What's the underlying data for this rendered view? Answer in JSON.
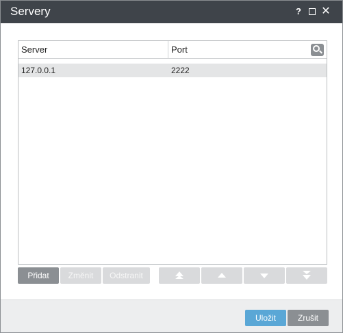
{
  "window": {
    "title": "Servery",
    "help_glyph": "?",
    "close_glyph": "✕"
  },
  "table": {
    "columns": [
      "Server",
      "Port"
    ],
    "rows": [
      {
        "server": "127.0.0.1",
        "port": "2222"
      }
    ]
  },
  "toolbar": {
    "add_label": "Přidat",
    "edit_label": "Změnit",
    "delete_label": "Odstranit"
  },
  "footer": {
    "save_label": "Uložit",
    "cancel_label": "Zrušit"
  },
  "colors": {
    "titlebar": "#3f444a",
    "primary_button": "#5aa7d6",
    "secondary_button": "#8b8f93",
    "disabled_button": "#d9dadc",
    "selected_row": "#e4e5e6"
  },
  "icons": {
    "search": "search-icon",
    "move_top": "double-chevron-up-icon",
    "move_up": "arrow-up-icon",
    "move_down": "arrow-down-icon",
    "move_bottom": "double-chevron-down-icon"
  }
}
